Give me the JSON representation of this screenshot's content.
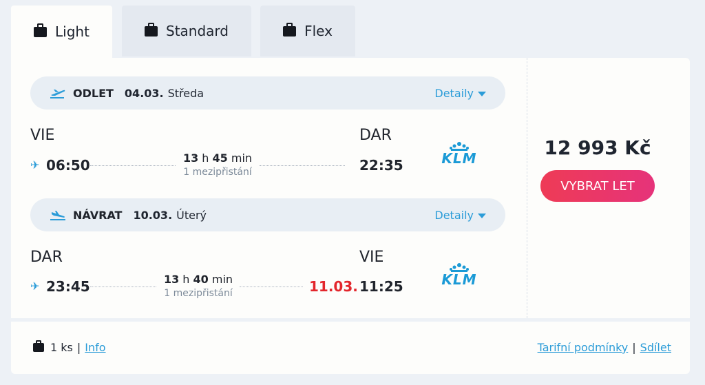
{
  "tabs": [
    {
      "label": "Light",
      "icon": "suitcase-icon",
      "active": true
    },
    {
      "label": "Standard",
      "icon": "suitcase-icon",
      "active": false
    },
    {
      "label": "Flex",
      "icon": "suitcase-icon",
      "active": false
    }
  ],
  "outbound": {
    "label": "ODLET",
    "date": "04.03.",
    "day": "Středa",
    "details_label": "Detaily",
    "from_code": "VIE",
    "to_code": "DAR",
    "dep_time": "06:50",
    "arr_time": "22:35",
    "duration_h": "13",
    "duration_h_unit": "h",
    "duration_m": "45",
    "duration_m_unit": "min",
    "stops": "1 mezipřistání",
    "airline": "KLM"
  },
  "inbound": {
    "label": "NÁVRAT",
    "date": "10.03.",
    "day": "Úterý",
    "details_label": "Detaily",
    "from_code": "DAR",
    "to_code": "VIE",
    "dep_time": "23:45",
    "arr_time": "11:25",
    "arrival_date": "11.03.",
    "duration_h": "13",
    "duration_h_unit": "h",
    "duration_m": "40",
    "duration_m_unit": "min",
    "stops": "1 mezipřistání",
    "airline": "KLM"
  },
  "price": "12 993 Kč",
  "select_button": "VYBRAT LET",
  "footer": {
    "bags": "1 ks",
    "info_link": "Info",
    "terms_link": "Tarifní podmínky",
    "share_link": "Sdílet"
  },
  "colors": {
    "accent": "#2b9cd8",
    "button_start": "#ee3b56",
    "button_end": "#e6337a",
    "next_day": "#e3262c",
    "airline": "#1b9ad6"
  }
}
